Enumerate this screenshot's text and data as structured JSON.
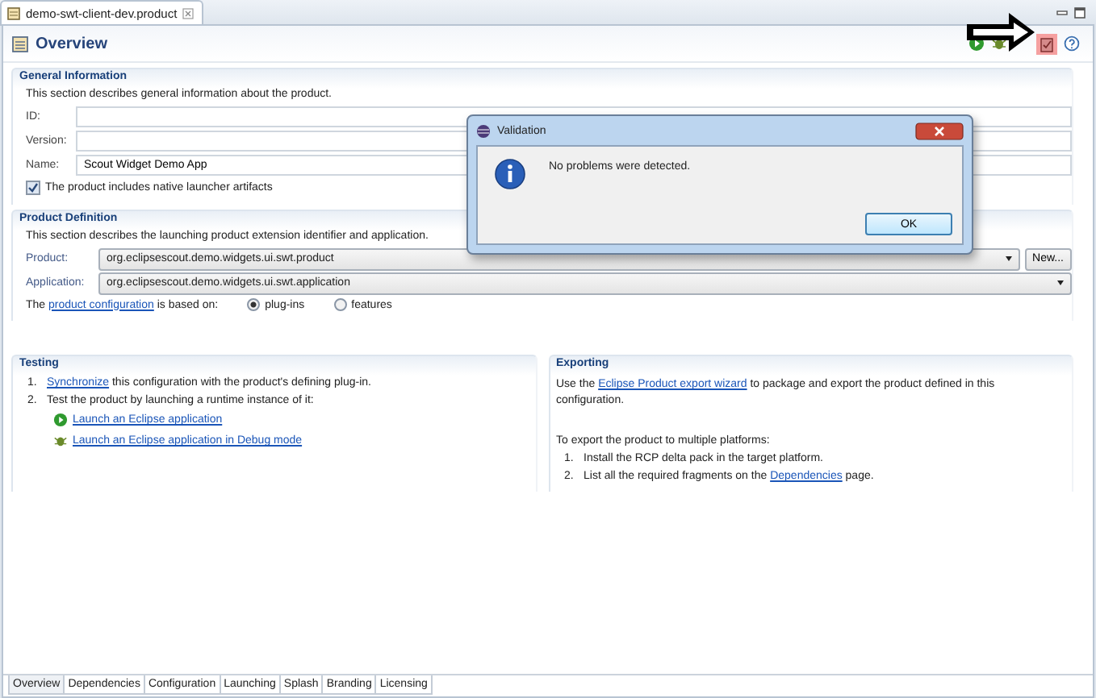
{
  "editor_tab": {
    "title": "demo-swt-client-dev.product"
  },
  "header": {
    "title": "Overview"
  },
  "general_information": {
    "title": "General Information",
    "description": "This section describes general information about the product.",
    "fields": [
      {
        "label": "ID:"
      },
      {
        "label": "Version:"
      },
      {
        "label": "Name:",
        "value": "Scout Widget Demo App"
      }
    ],
    "native_launcher": {
      "label": "The product includes native launcher artifacts",
      "checked": true
    }
  },
  "product_definition": {
    "title": "Product Definition",
    "description": "This section describes the launching product extension identifier and application.",
    "product": {
      "label": "Product:",
      "value": "org.eclipsescout.demo.widgets.ui.swt.product"
    },
    "new_button": "New...",
    "application": {
      "label": "Application:",
      "value": "org.eclipsescout.demo.widgets.ui.swt.application"
    },
    "based_on": {
      "before": "The ",
      "link": "product configuration",
      "after": " is based on:",
      "options": [
        {
          "label": "plug-ins",
          "selected": true
        },
        {
          "label": "features",
          "selected": false
        }
      ]
    }
  },
  "testing": {
    "title": "Testing",
    "steps": [
      {
        "number": "1.",
        "link": "Synchronize",
        "after": " this configuration with the product's defining plug-in."
      },
      {
        "number": "2.",
        "before": "Test the product by launching a runtime instance of it:"
      }
    ],
    "launch_links": [
      {
        "kind": "run",
        "label": "Launch an Eclipse application"
      },
      {
        "kind": "debug",
        "label": "Launch an Eclipse application in Debug mode"
      }
    ]
  },
  "exporting": {
    "title": "Exporting",
    "before": "Use the ",
    "link": "Eclipse Product export wizard",
    "after": " to package and export the product defined in this configuration.",
    "intro": "To export the product to multiple platforms:",
    "steps": [
      {
        "number": "1.",
        "before": "Install the RCP delta pack in the target platform."
      },
      {
        "number": "2.",
        "before": "List all the required fragments on the ",
        "link": "Dependencies",
        "after": " page."
      }
    ]
  },
  "bottom_tabs": [
    {
      "label": "Overview",
      "selected": true
    },
    {
      "label": "Dependencies",
      "selected": false
    },
    {
      "label": "Configuration",
      "selected": false
    },
    {
      "label": "Launching",
      "selected": false
    },
    {
      "label": "Splash",
      "selected": false
    },
    {
      "label": "Branding",
      "selected": false
    },
    {
      "label": "Licensing",
      "selected": false
    }
  ],
  "dialog": {
    "title": "Validation",
    "message": "No problems were detected.",
    "button": "OK"
  }
}
